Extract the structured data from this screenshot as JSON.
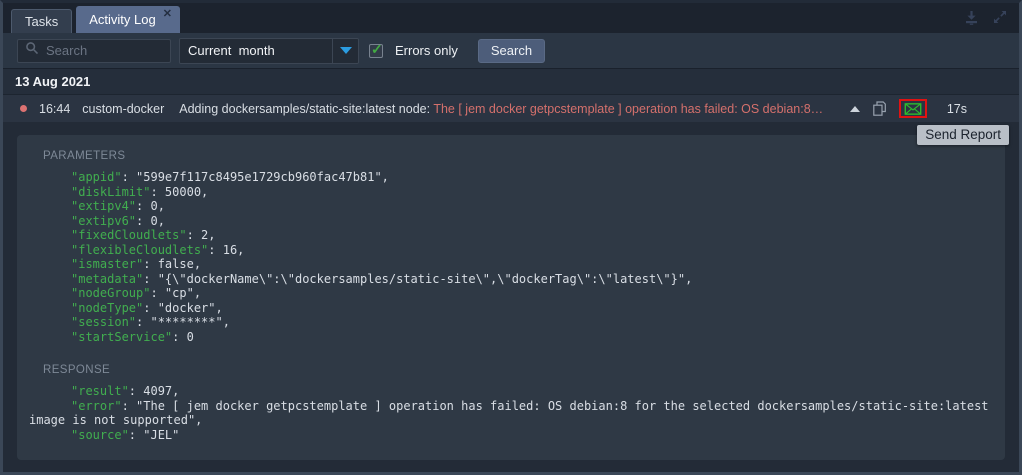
{
  "tabs": {
    "tasks": "Tasks",
    "activity_log": "Activity Log"
  },
  "icons": {
    "close_glyph": "✕",
    "check_glyph": "✓"
  },
  "toolbar": {
    "search_placeholder": "Search",
    "period_value": "Current  month",
    "errors_only_label": "Errors only",
    "search_button": "Search"
  },
  "log": {
    "date_header": "13 Aug 2021",
    "row": {
      "time": "16:44",
      "type": "custom-docker",
      "message": "Adding dockersamples/static-site:latest node: ",
      "error_preview": "The [ jem docker getpcstemplate ] operation has failed: OS debian:8…",
      "duration": "17s"
    },
    "tooltip": "Send Report"
  },
  "details": {
    "parameters_label": "PARAMETERS",
    "parameters": [
      {
        "key": "\"appid\"",
        "rest": ": \"599e7f117c8495e1729cb960fac47b81\","
      },
      {
        "key": "\"diskLimit\"",
        "rest": ": 50000,"
      },
      {
        "key": "\"extipv4\"",
        "rest": ": 0,"
      },
      {
        "key": "\"extipv6\"",
        "rest": ": 0,"
      },
      {
        "key": "\"fixedCloudlets\"",
        "rest": ": 2,"
      },
      {
        "key": "\"flexibleCloudlets\"",
        "rest": ": 16,"
      },
      {
        "key": "\"ismaster\"",
        "rest": ": false,"
      },
      {
        "key": "\"metadata\"",
        "rest": ": \"{\\\"dockerName\\\":\\\"dockersamples/static-site\\\",\\\"dockerTag\\\":\\\"latest\\\"}\","
      },
      {
        "key": "\"nodeGroup\"",
        "rest": ": \"cp\","
      },
      {
        "key": "\"nodeType\"",
        "rest": ": \"docker\","
      },
      {
        "key": "\"session\"",
        "rest": ": \"********\","
      },
      {
        "key": "\"startService\"",
        "rest": ": 0"
      }
    ],
    "response_label": "RESPONSE",
    "response": [
      {
        "key": "\"result\"",
        "rest": ": 4097,"
      },
      {
        "key": "\"error\"",
        "rest": ": \"The [ jem docker getpcstemplate ] operation has failed: OS debian:8 for the selected dockersamples/static-site:latest image is not supported\","
      },
      {
        "key": "\"source\"",
        "rest": ": \"JEL\""
      }
    ]
  },
  "colors": {
    "accent_blue": "#2b9ce0",
    "error_red": "#d4706c",
    "status_dot_red": "#dc7272",
    "key_green": "#41ae4f",
    "check_green": "#43aa43",
    "envelope_green": "#2ebd2e",
    "highlight_red": "#e01212",
    "active_tab": "#586a8c"
  }
}
